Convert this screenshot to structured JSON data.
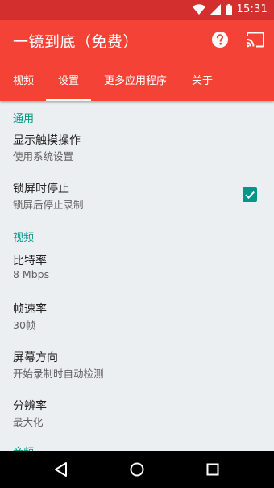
{
  "status_bar": {
    "time": "15:31"
  },
  "app_bar": {
    "title": "一镜到底（免费）"
  },
  "tabs": [
    {
      "label": "视频"
    },
    {
      "label": "设置"
    },
    {
      "label": "更多应用程序"
    },
    {
      "label": "关于"
    }
  ],
  "selected_tab": "设置",
  "sections": [
    {
      "header": "通用",
      "items": [
        {
          "title": "显示触摸操作",
          "summary": "使用系统设置"
        },
        {
          "title": "锁屏时停止",
          "summary": "锁屏后停止录制",
          "checked": true
        }
      ]
    },
    {
      "header": "视频",
      "items": [
        {
          "title": "比特率",
          "summary": "8 Mbps"
        },
        {
          "title": "帧速率",
          "summary": "30帧"
        },
        {
          "title": "屏幕方向",
          "summary": "开始录制时自动检测"
        },
        {
          "title": "分辨率",
          "summary": "最大化"
        }
      ]
    },
    {
      "header": "音频",
      "items": []
    }
  ],
  "colors": {
    "status_bar": "#D32F2F",
    "app_bar": "#F44336",
    "accent": "#009688",
    "background": "#ECEFF1",
    "nav_bar": "#000000"
  },
  "icons": {
    "status": [
      "wifi-icon",
      "signal-icon",
      "battery-icon"
    ],
    "app_bar": [
      "help-icon",
      "cast-icon"
    ],
    "nav": [
      "back-icon",
      "home-icon",
      "recents-icon"
    ]
  }
}
